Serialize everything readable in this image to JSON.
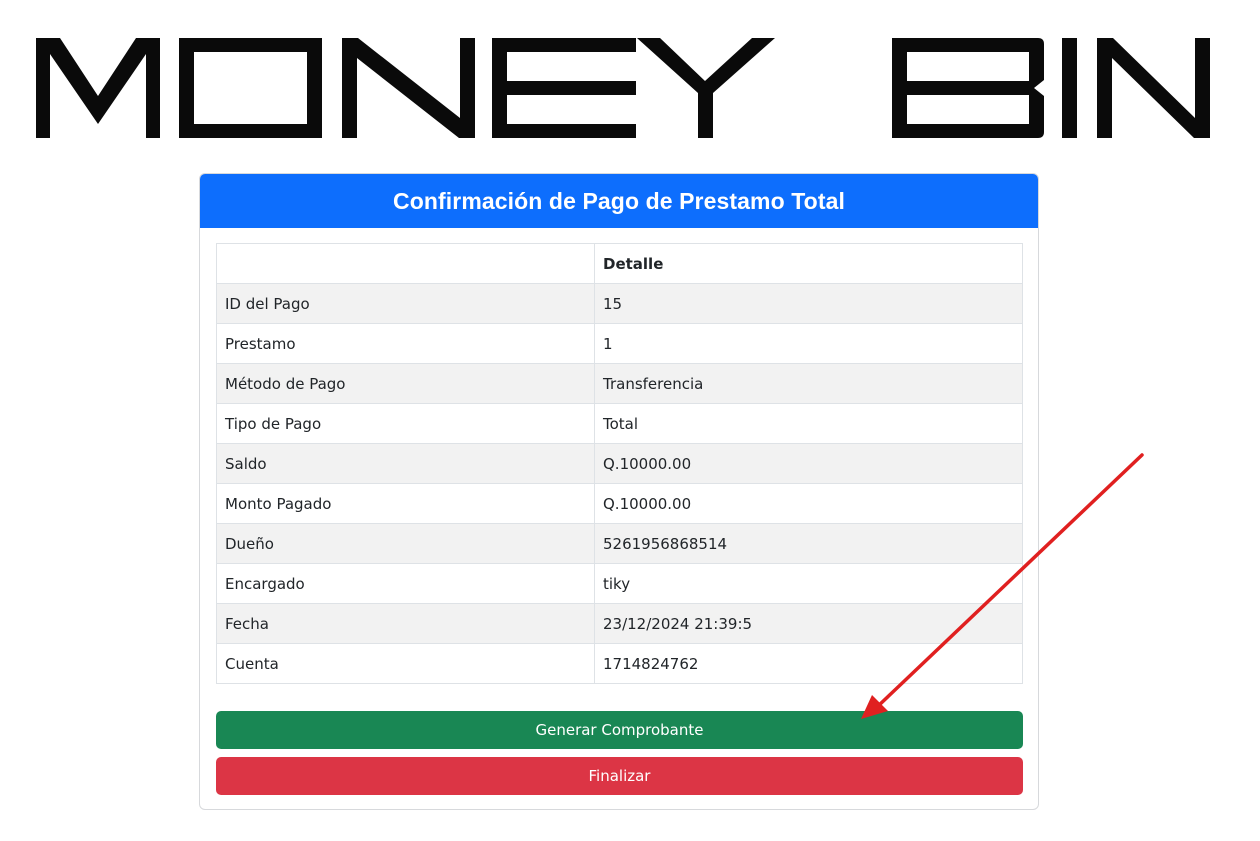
{
  "logo": {
    "text": "MONEY BIN"
  },
  "card": {
    "title": "Confirmación de Pago de Prestamo Total",
    "table": {
      "header": [
        "",
        "Detalle"
      ],
      "rows": [
        [
          "ID del Pago",
          "15"
        ],
        [
          "Prestamo",
          "1"
        ],
        [
          "Método de Pago",
          "Transferencia"
        ],
        [
          "Tipo de Pago",
          "Total"
        ],
        [
          "Saldo",
          "Q.10000.00"
        ],
        [
          "Monto Pagado",
          "Q.10000.00"
        ],
        [
          "Dueño",
          "5261956868514"
        ],
        [
          "Encargado",
          "tiky"
        ],
        [
          "Fecha",
          "23/12/2024 21:39:5"
        ],
        [
          "Cuenta",
          "1714824762"
        ]
      ]
    },
    "buttons": {
      "generate": "Generar Comprobante",
      "finish": "Finalizar"
    }
  },
  "colors": {
    "header": "#0d6efd",
    "success": "#198754",
    "danger": "#dc3545",
    "annotation_arrow": "#e02020"
  }
}
